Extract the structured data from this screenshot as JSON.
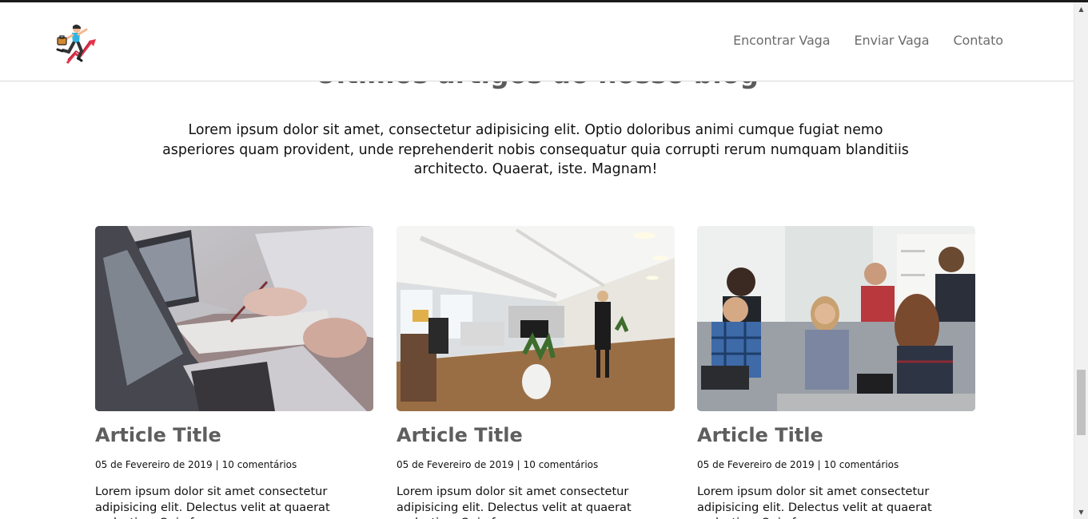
{
  "navbar": {
    "logo": "runner-growth-chart-icon",
    "links": [
      "Encontrar Vaga",
      "Enviar Vaga",
      "Contato"
    ]
  },
  "blog": {
    "title": "Últimos artigos do nosso blog",
    "intro": "Lorem ipsum dolor sit amet, consectetur adipisicing elit. Optio doloribus animi cumque fugiat nemo asperiores quam provident, unde reprehenderit nobis consequatur quia corrupti rerum numquam blanditiis architecto. Quaerat, iste. Magnam!",
    "articles": [
      {
        "image": "laptop-meeting-photo",
        "title": "Article Title",
        "date": "05 de Fevereiro de 2019",
        "separator": "|",
        "comments": "10 comentários",
        "excerpt": "Lorem ipsum dolor sit amet consectetur adipisicing elit. Delectus velit at quaerat molestiae. Quia facere,"
      },
      {
        "image": "open-office-photo",
        "title": "Article Title",
        "date": "05 de Fevereiro de 2019",
        "separator": "|",
        "comments": "10 comentários",
        "excerpt": "Lorem ipsum dolor sit amet consectetur adipisicing elit. Delectus velit at quaerat molestiae. Quia facere,"
      },
      {
        "image": "team-discussion-photo",
        "title": "Article Title",
        "date": "05 de Fevereiro de 2019",
        "separator": "|",
        "comments": "10 comentários",
        "excerpt": "Lorem ipsum dolor sit amet consectetur adipisicing elit. Delectus velit at quaerat molestiae. Quia facere,"
      }
    ]
  },
  "scrollbar": {
    "up": "▲",
    "down": "▼"
  },
  "colors": {
    "heading": "#5e5e5e",
    "nav": "#6c6c6c",
    "text": "#111111"
  }
}
